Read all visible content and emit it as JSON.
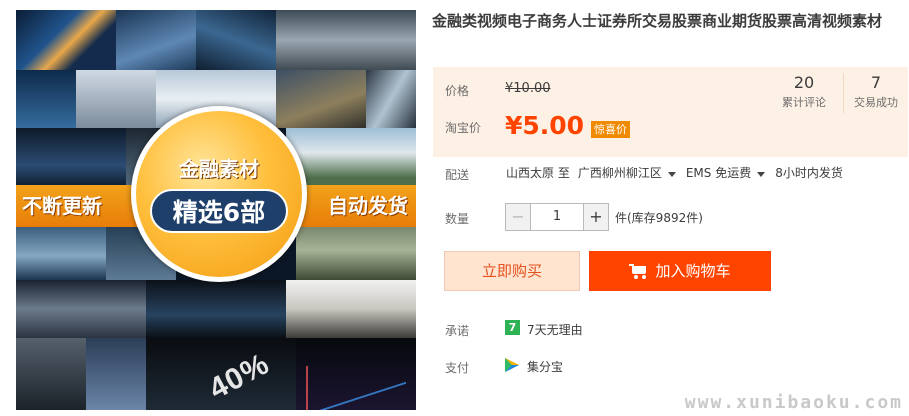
{
  "product_image": {
    "band_left": "不断更新",
    "band_right": "自动发货",
    "circle_top": "金融素材",
    "circle_main": "精选6部",
    "overlay_percent": "40%"
  },
  "title": "金融类视频电子商务人士证券所交易股票商业期货股票高清视频素材",
  "price": {
    "price_label": "价格",
    "original_price": "¥10.00",
    "promo_label": "淘宝价",
    "promo_price": "¥5.00",
    "promo_badge": "惊喜价"
  },
  "stats": {
    "reviews_count": "20",
    "reviews_label": "累计评论",
    "sales_count": "7",
    "sales_label": "交易成功"
  },
  "shipping": {
    "label": "配送",
    "origin": "山西太原 至",
    "destination": "广西柳州柳江区",
    "method": "EMS 免运费",
    "time": "8小时内发货"
  },
  "quantity": {
    "label": "数量",
    "value": "1",
    "minus": "−",
    "plus": "+",
    "stock": "件(库存9892件)"
  },
  "actions": {
    "buy_now": "立即购买",
    "add_to_cart": "加入购物车"
  },
  "promise": {
    "label": "承诺",
    "icon_text": "7",
    "text": "7天无理由"
  },
  "payment": {
    "label": "支付",
    "text": "集分宝"
  },
  "watermark": "www.xunibaoku.com",
  "colors": {
    "accent": "#ff4400",
    "price_bg": "#fdf0e5",
    "badge": "#f08a00",
    "promise_green": "#2eb253"
  }
}
